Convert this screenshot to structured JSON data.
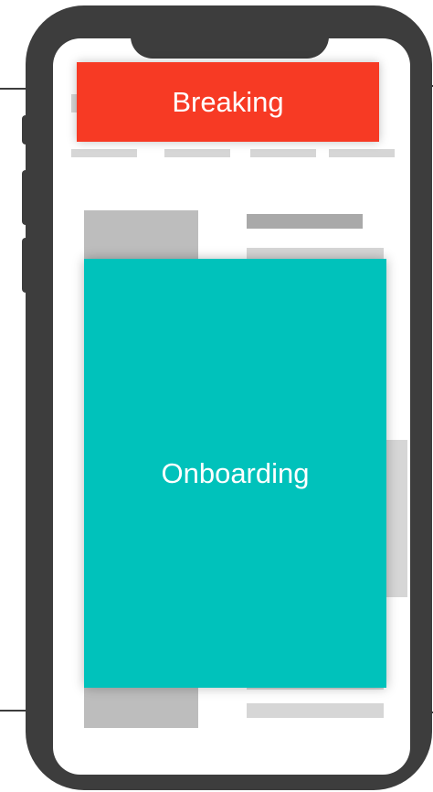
{
  "banner": {
    "label": "Breaking",
    "color": "#f73a24"
  },
  "onboarding": {
    "label": "Onboarding",
    "color": "#00c2bb"
  },
  "device": {
    "frame_color": "#3d3d3d"
  }
}
